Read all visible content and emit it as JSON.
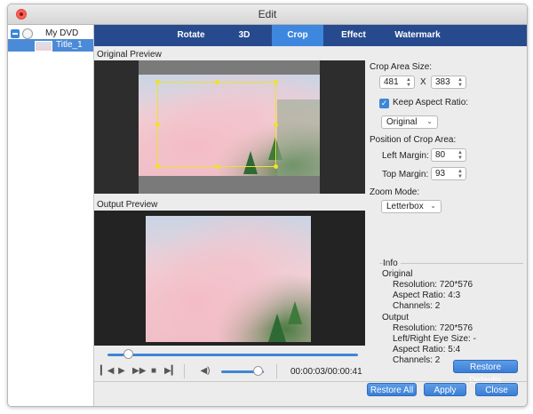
{
  "window": {
    "title": "Edit"
  },
  "sidebar": {
    "root_label": "My DVD",
    "child_label": "Title_1"
  },
  "tabs": [
    {
      "label": "Rotate",
      "active": false
    },
    {
      "label": "3D",
      "active": false
    },
    {
      "label": "Crop",
      "active": true
    },
    {
      "label": "Effect",
      "active": false
    },
    {
      "label": "Watermark",
      "active": false
    }
  ],
  "preview": {
    "original_label": "Original Preview",
    "output_label": "Output Preview"
  },
  "playback": {
    "progress_fraction": 0.08,
    "volume_fraction": 0.85,
    "timecode": "00:00:03/00:00:41"
  },
  "crop": {
    "area_size_label": "Crop Area Size:",
    "width": "481",
    "x_label": "X",
    "height": "383",
    "keep_aspect_label": "Keep Aspect Ratio:",
    "keep_aspect_checked": true,
    "aspect_option": "Original",
    "position_label": "Position of Crop Area:",
    "left_margin_label": "Left Margin:",
    "left_margin": "80",
    "top_margin_label": "Top Margin:",
    "top_margin": "93",
    "zoom_mode_label": "Zoom Mode:",
    "zoom_mode": "Letterbox"
  },
  "info": {
    "heading": "Info",
    "original_heading": "Original",
    "original_resolution": "Resolution: 720*576",
    "original_aspect": "Aspect Ratio: 4:3",
    "original_channels": "Channels: 2",
    "output_heading": "Output",
    "output_resolution": "Resolution: 720*576",
    "output_eye_size": "Left/Right Eye Size: -",
    "output_aspect": "Aspect Ratio: 5:4",
    "output_channels": "Channels: 2"
  },
  "buttons": {
    "restore_defaults": "Restore Defaults",
    "restore_all": "Restore All",
    "apply": "Apply",
    "close": "Close"
  },
  "colors": {
    "tab_bar": "#274a8e",
    "tab_active": "#3f87de",
    "accent": "#3d86d8",
    "crop_rect": "#f0e12a"
  }
}
